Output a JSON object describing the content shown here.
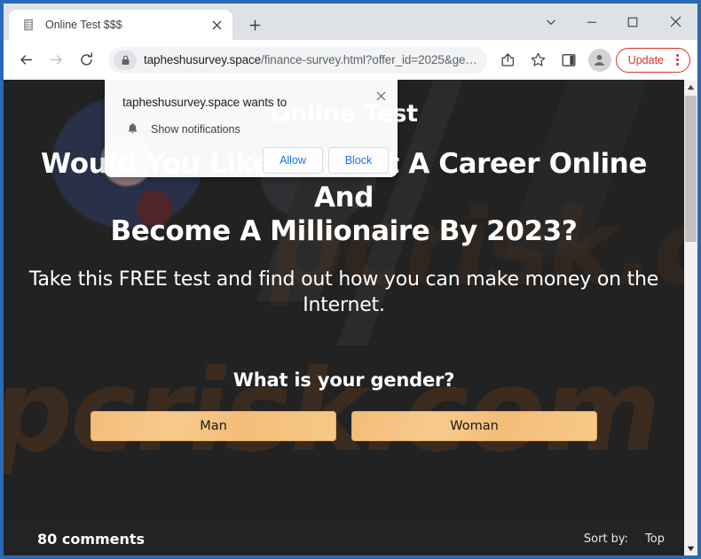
{
  "window": {
    "controls": {
      "tab_search": "tab-search",
      "minimize": "minimize",
      "maximize": "maximize",
      "close": "close"
    }
  },
  "tabstrip": {
    "tabs": [
      {
        "title": "Online Test $$$",
        "favicon": "document-icon",
        "close_label": "✕"
      }
    ],
    "new_tab_label": "+"
  },
  "toolbar": {
    "back_icon": "back-arrow-icon",
    "forward_icon": "forward-arrow-icon",
    "reload_icon": "reload-icon",
    "lock_icon": "lock-icon",
    "url_host": "tapheshusurvey.space",
    "url_path": "/finance-survey.html?offer_id=2025&ge…",
    "share_icon": "share-icon",
    "bookmark_icon": "star-icon",
    "sidepanel_icon": "side-panel-icon",
    "profile_icon": "profile-avatar-icon",
    "update_label": "Update",
    "menu_icon": "three-dot-menu-icon"
  },
  "permission_popup": {
    "title": "tapheshusurvey.space wants to",
    "permission_icon": "bell-icon",
    "permission_label": "Show notifications",
    "allow_label": "Allow",
    "block_label": "Block",
    "close_label": "✕"
  },
  "page": {
    "site_title": "Online Test",
    "headline_line1": "Would You Like To Start A Career Online And",
    "headline_line2": "Become A Millionaire By 2023?",
    "subhead_line1": "Take this FREE test and find out how you can make money on the",
    "subhead_line2": "Internet.",
    "question": "What is your gender?",
    "answers": [
      {
        "label": "Man"
      },
      {
        "label": "Woman"
      }
    ],
    "watermark_text": "pcrisk.com",
    "colors": {
      "background": "#222222",
      "button": "#f5c283",
      "text": "#ffffff",
      "update_accent": "#d93025"
    }
  },
  "comments_bar": {
    "count_label": "80 comments",
    "sort_label": "Sort by:",
    "sort_value": "Top"
  },
  "scrollbar": {
    "up_arrow": "scroll-up-arrow-icon",
    "down_arrow": "scroll-down-arrow-icon"
  }
}
